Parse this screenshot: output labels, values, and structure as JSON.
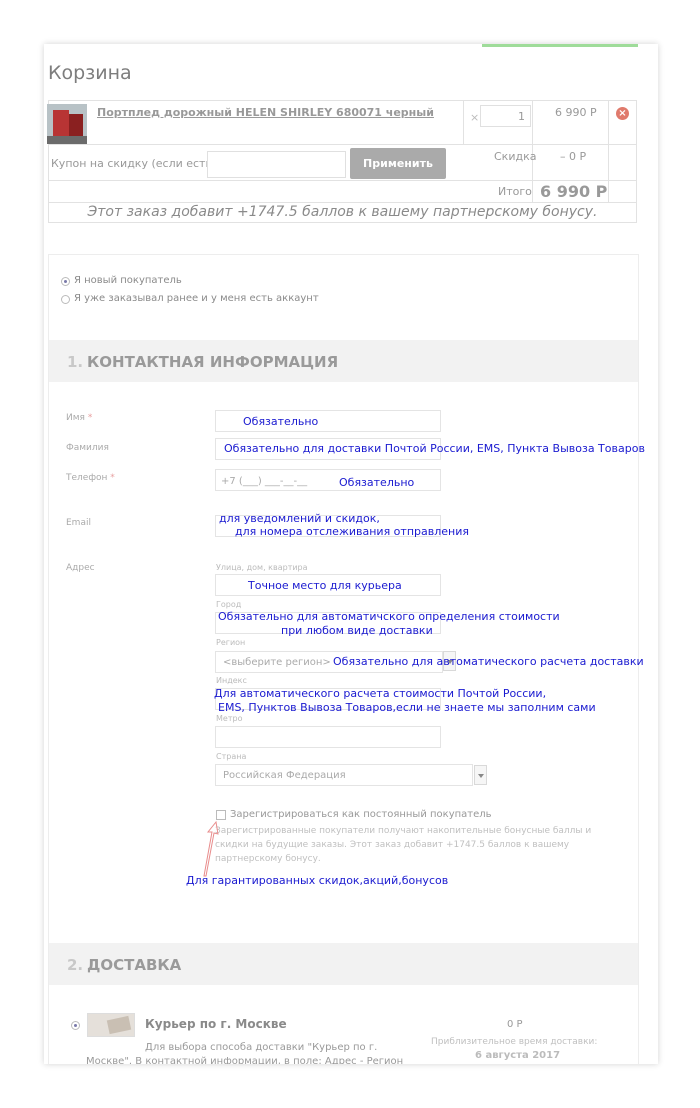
{
  "cart": {
    "title": "Корзина",
    "product_name": "Портплед дорожный HELEN SHIRLEY 680071 черный",
    "times_sign": "×",
    "quantity": "1",
    "price": "6 990 Р",
    "remove_symbol": "×",
    "coupon_label": "Купон на скидку (если есть):",
    "coupon_value": "",
    "apply_button": "Применить",
    "discount_label": "Скидка",
    "discount_value": "– 0 Р",
    "total_label": "Итого",
    "total_value": "6 990 Р",
    "bonus_note": "Этот заказ добавит +1747.5 баллов к вашему партнерскому бонусу."
  },
  "customer_type": {
    "options": [
      "Я новый покупатель",
      "Я уже заказывал ранее и у меня есть аккаунт"
    ],
    "selected": 0
  },
  "contact": {
    "number": "1.",
    "title": "КОНТАКТНАЯ ИНФОРМАЦИЯ",
    "fields": {
      "name_label": "Имя",
      "surname_label": "Фамилия",
      "phone_label": "Телефон",
      "phone_placeholder": "+7 (___) ___-__-__",
      "email_label": "Email",
      "address_label": "Адрес",
      "street_sublabel": "Улица, дом, квартира",
      "city_sublabel": "Город",
      "region_sublabel": "Регион",
      "region_value": "<выберите регион>",
      "index_sublabel": "Индекс",
      "metro_sublabel": "Метро",
      "country_sublabel": "Страна",
      "country_value": "Российская Федерация",
      "required_mark": "*"
    },
    "register_label": "Зарегистрироваться как постоянный покупатель",
    "register_note_1": "Зарегистрированные покупатели получают накопительные бонусные баллы и",
    "register_note_2": "скидки на будущие заказы. Этот заказ добавит +1747.5 баллов к вашему",
    "register_note_3": "партнерскому бонусу."
  },
  "annotations": {
    "name": "Обязательно",
    "surname": "Обязательно для доставки Почтой России, EMS, Пункта Вывоза Товаров",
    "phone": "Обязательно",
    "email_1": "для уведомлений и скидок,",
    "email_2": "для номера отслеживания отправления",
    "street": "Точное место для курьера",
    "city_1": "Обязательно для автоматичского определения стоимости",
    "city_2": "при любом виде доставки",
    "region": "Обязательно для автоматического расчета доставки",
    "index_1": "Для автоматического расчета стоимости Почтой России,",
    "index_2": "EMS, Пунктов Вывоза Товаров,если не знаете мы заполним сами",
    "register": "Для гарантированных скидок,акций,бонусов"
  },
  "delivery": {
    "number": "2.",
    "title": "ДОСТАВКА",
    "option_title": "Курьер по г. Москве",
    "option_desc_1": "Для выбора способа доставки \"Курьер по г.",
    "option_desc_2": "Москве\". В контактной информации, в поле: Адрес - Регион",
    "price": "0 Р",
    "eta_label": "Приблизительное время доставки:",
    "eta_date": "6 августа 2017"
  },
  "colors": {
    "annotation": "#1a1ad0",
    "accent_top": "#9fdc9a",
    "remove": "#e07a6c",
    "button": "#aaaaaa"
  }
}
